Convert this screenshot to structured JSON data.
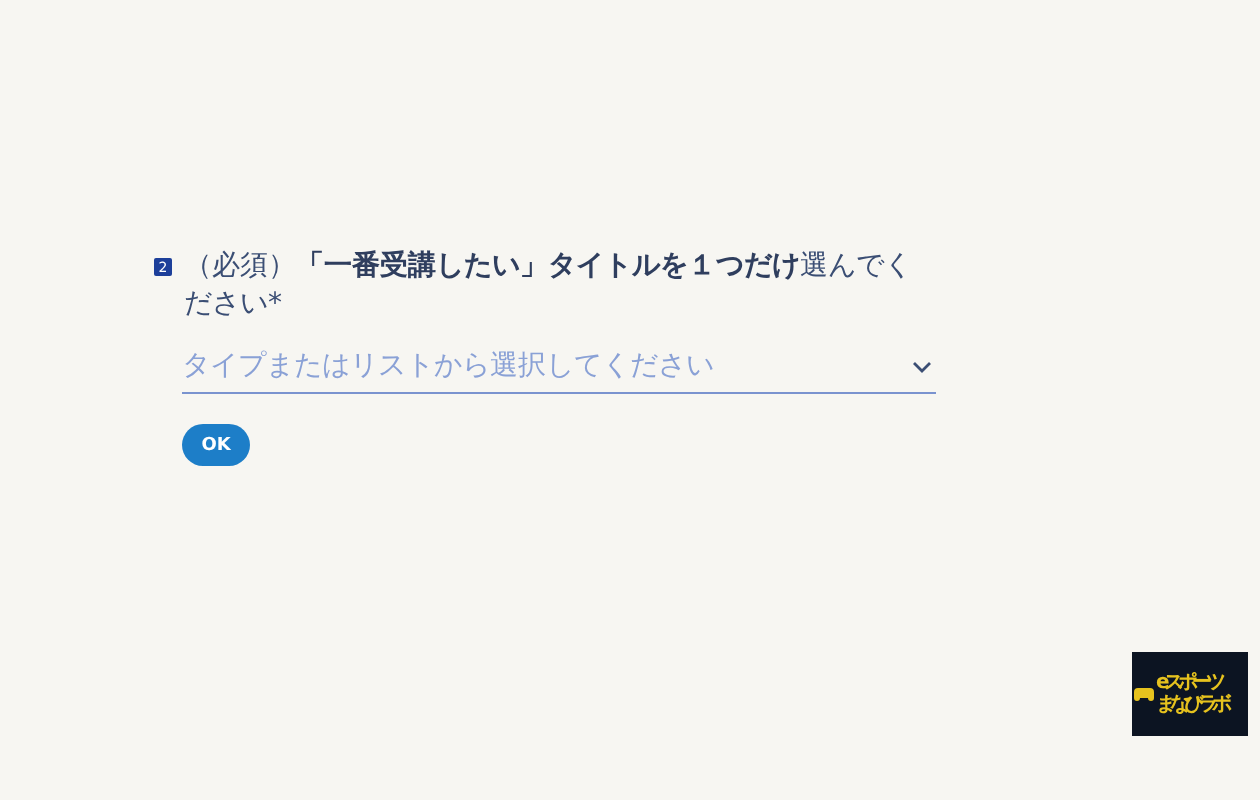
{
  "question": {
    "number": "2",
    "text": "（必須）**「一番受講したい」タイトルを１つだけ**選んでください*"
  },
  "dropdown": {
    "placeholder": "タイプまたはリストから選択してください",
    "expanded": false
  },
  "ok_button": "OK",
  "logo": {
    "line_1": "eスポーツ",
    "line_2": "まなびラボ"
  }
}
